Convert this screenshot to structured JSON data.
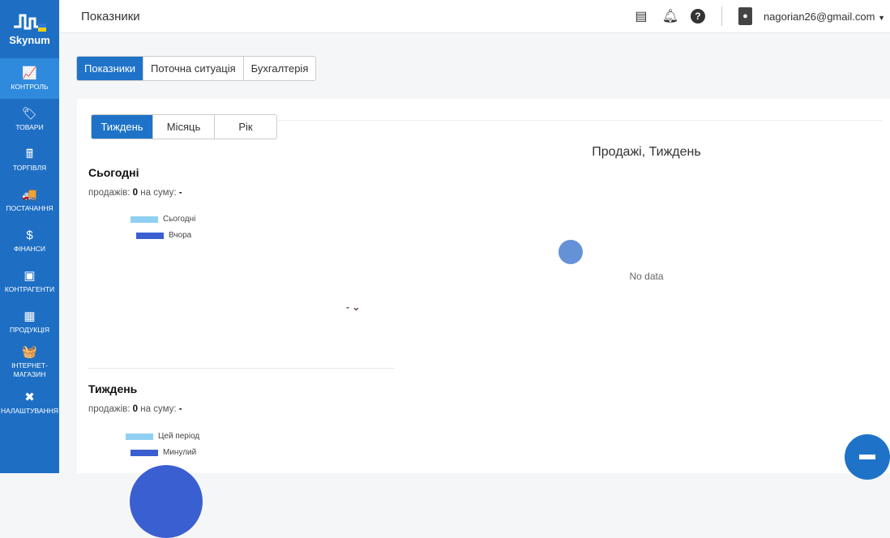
{
  "brand": "Skynum",
  "sidebar": {
    "items": [
      {
        "label": "КОНТРОЛЬ",
        "icon": "chart-icon",
        "glyph": "📈"
      },
      {
        "label": "ТОВАРИ",
        "icon": "tag-icon",
        "glyph": "🏷"
      },
      {
        "label": "ТОРГІВЛЯ",
        "icon": "cash-register-icon",
        "glyph": "🖩"
      },
      {
        "label": "ПОСТАЧАННЯ",
        "icon": "truck-icon",
        "glyph": "🚚"
      },
      {
        "label": "ФІНАНСИ",
        "icon": "hand-dollar-icon",
        "glyph": "$"
      },
      {
        "label": "КОНТРАГЕНТИ",
        "icon": "id-card-icon",
        "glyph": "▣"
      },
      {
        "label": "ПРОДУКЦІЯ",
        "icon": "box-icon",
        "glyph": "▦"
      },
      {
        "label": "ІНТЕРНЕТ-МАГАЗИН",
        "icon": "basket-icon",
        "glyph": "🧺"
      },
      {
        "label": "НАЛАШТУВАННЯ",
        "icon": "tools-icon",
        "glyph": "✖"
      }
    ]
  },
  "header": {
    "title": "Показники",
    "email": "nagorian26@gmail.com"
  },
  "tabs": [
    "Показники",
    "Поточна ситуація",
    "Бухгалтерія"
  ],
  "periods": [
    "Тиждень",
    "Місяць",
    "Рік"
  ],
  "today": {
    "title": "Сьогодні",
    "sales_label": "продажів:",
    "sales": "0",
    "sum_label": "на суму:",
    "sum": "-",
    "legend": [
      "Сьогодні",
      "Вчора"
    ],
    "delta": "-"
  },
  "week": {
    "title": "Тиждень",
    "sales_label": "продажів:",
    "sales": "0",
    "sum_label": "на суму:",
    "sum": "-",
    "legend": [
      "Цей період",
      "Минулий"
    ]
  },
  "chart": {
    "title": "Продажі, Тиждень",
    "empty": "No data"
  },
  "colors": {
    "sidebar": "#1e6fc4",
    "accent": "#1e73c8",
    "legend_light": "#8fd0f2",
    "legend_dark": "#3a5fd0"
  }
}
